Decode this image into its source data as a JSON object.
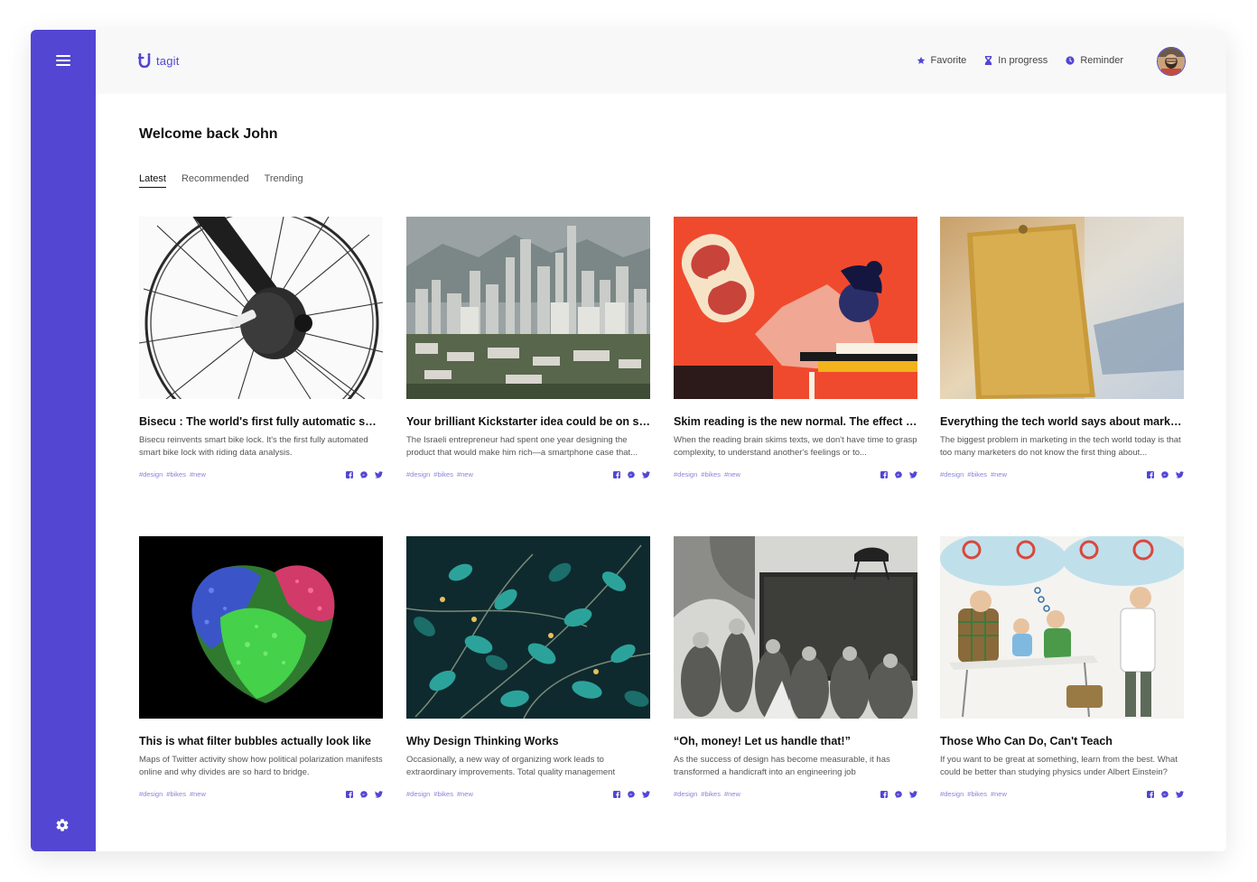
{
  "app": {
    "name": "tagit",
    "accent": "#5246d3"
  },
  "header": {
    "nav": [
      {
        "label": "Favorite",
        "icon": "star-icon"
      },
      {
        "label": "In progress",
        "icon": "hourglass-icon"
      },
      {
        "label": "Reminder",
        "icon": "clock-icon"
      }
    ]
  },
  "main": {
    "welcome": "Welcome back John",
    "tabs": [
      {
        "label": "Latest",
        "active": true
      },
      {
        "label": "Recommended",
        "active": false
      },
      {
        "label": "Trending",
        "active": false
      }
    ]
  },
  "cards": [
    {
      "title": "Bisecu : The world's first fully automatic smart bike lock",
      "desc": "Bisecu reinvents smart bike lock. It's the first fully automated smart bike lock with riding data analysis.",
      "tags": [
        "#design",
        "#bikes",
        "#new"
      ],
      "image": "bike-wheel-image"
    },
    {
      "title": "Your brilliant Kickstarter idea could be on sale",
      "desc": "The Israeli entrepreneur had spent one year designing the product that would make him rich—a smartphone case that...",
      "tags": [
        "#design",
        "#bikes",
        "#new"
      ],
      "image": "city-skyline-image"
    },
    {
      "title": "Skim reading is the new normal. The effect on society",
      "desc": "When the reading brain skims texts, we don't have time to grasp complexity, to understand another's feelings or to...",
      "tags": [
        "#design",
        "#bikes",
        "#new"
      ],
      "image": "skim-reading-illustration"
    },
    {
      "title": "Everything the tech world says about marketing",
      "desc": "The biggest problem in marketing in the tech world today is that too many marketers do not know the first thing about...",
      "tags": [
        "#design",
        "#bikes",
        "#new"
      ],
      "image": "no-sale-sign-image"
    },
    {
      "title": "This is what filter bubbles actually look like",
      "desc": "Maps of Twitter activity show how political polarization manifests online and why divides are so hard to bridge.",
      "tags": [
        "#design",
        "#bikes",
        "#new"
      ],
      "image": "filter-bubble-visualization"
    },
    {
      "title": "Why Design Thinking Works",
      "desc": "Occasionally, a new way of organizing work leads to extraordinary improvements. Total quality management",
      "tags": [
        "#design",
        "#bikes",
        "#new"
      ],
      "image": "vine-leaves-illustration"
    },
    {
      "title": "“Oh, money! Let us handle that!”",
      "desc": "As the success of design has become measurable, it has transformed a handicraft into an engineering job",
      "tags": [
        "#design",
        "#bikes",
        "#new"
      ],
      "image": "engraving-crowd-image"
    },
    {
      "title": "Those Who Can Do, Can't Teach",
      "desc": "If you want to be great at something, learn from the best. What could be better than studying physics under Albert Einstein?",
      "tags": [
        "#design",
        "#bikes",
        "#new"
      ],
      "image": "teaching-illustration"
    }
  ]
}
